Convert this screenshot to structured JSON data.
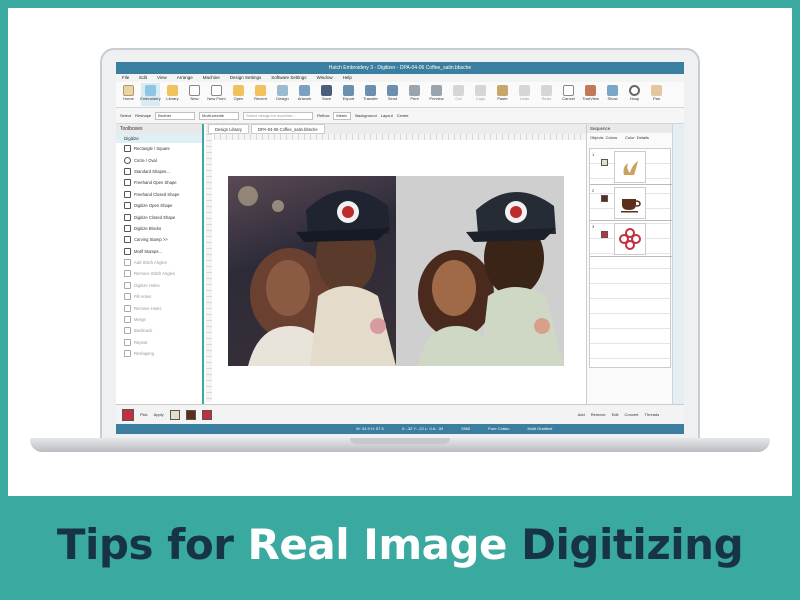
{
  "headline": {
    "part1": "Tips for ",
    "part2": "Real Image",
    "part3": " Digitizing"
  },
  "colors": {
    "teal": "#3aa99f",
    "navy": "#173446",
    "app_blue": "#3a7fa0"
  },
  "app": {
    "title": "Hatch Embroidery 3 - Digitizer - DPA-04-06 Coffee_satin.bbsche",
    "menu": [
      "File",
      "Edit",
      "View",
      "Arrange",
      "Machine",
      "Design Settings",
      "Software Settings",
      "Window",
      "Help"
    ],
    "ribbon": [
      {
        "label": "Home",
        "icon": "home-icon"
      },
      {
        "label": "Embroidery",
        "icon": "embroidery-icon"
      },
      {
        "label": "Library",
        "icon": "library-icon"
      },
      {
        "label": "New",
        "icon": "new-icon"
      },
      {
        "label": "New From",
        "icon": "new-from-icon"
      },
      {
        "label": "Open",
        "icon": "open-icon"
      },
      {
        "label": "Recent",
        "icon": "recent-icon"
      },
      {
        "label": "Design",
        "icon": "design-icon"
      },
      {
        "label": "Artwork",
        "icon": "artwork-icon"
      },
      {
        "label": "Save",
        "icon": "save-icon"
      },
      {
        "label": "Export",
        "icon": "export-icon"
      },
      {
        "label": "Transfer",
        "icon": "transfer-icon"
      },
      {
        "label": "Send",
        "icon": "send-icon"
      },
      {
        "label": "Print",
        "icon": "print-icon"
      },
      {
        "label": "Preview",
        "icon": "preview-icon"
      },
      {
        "label": "Cut",
        "icon": "cut-icon"
      },
      {
        "label": "Copy",
        "icon": "copy-icon"
      },
      {
        "label": "Paste",
        "icon": "paste-icon"
      },
      {
        "label": "Undo",
        "icon": "undo-icon"
      },
      {
        "label": "Redo",
        "icon": "redo-icon"
      },
      {
        "label": "Cancel",
        "icon": "cancel-icon"
      },
      {
        "label": "TrueView",
        "icon": "trueview-icon"
      },
      {
        "label": "Show",
        "icon": "show-icon"
      },
      {
        "label": "Hoop",
        "icon": "hoop-icon"
      },
      {
        "label": "Pan",
        "icon": "pan-icon"
      }
    ],
    "options": {
      "select_label": "Select",
      "reshape_label": "Reshape",
      "brother_value": "Brother",
      "multi_needle_value": "Multi-needle",
      "search_placeholder": "Select design for machine...",
      "reflow_label": "Reflow",
      "metric_value": "Metric",
      "background_label": "Background",
      "layout_label": "Layout",
      "center_label": "Center"
    },
    "toolbox": {
      "title": "Toolboxes",
      "section": "Digitize",
      "items": [
        "Rectangle / Square",
        "Circle / Oval",
        "Standard Shapes...",
        "Freehand Open Shape",
        "Freehand Closed Shape",
        "Digitize Open Shape",
        "Digitize Closed Shape",
        "Digitize Blocks",
        "Carving Stamp >>",
        "Motif Stamps...",
        "Add Stitch Angles",
        "Remove Stitch Angles",
        "Digitize Holes",
        "Fill Holes",
        "Remove Holes",
        "Merge",
        "Backtrack",
        "Repeat",
        "Reshaping"
      ]
    },
    "tabs": [
      "Design Library",
      "DPA-04-06 Coffee_satin.bbsche"
    ],
    "sequence": {
      "title": "Sequence",
      "tab_objects": "Objects",
      "tab_colors": "Colors",
      "col_color": "Color",
      "col_details": "Details",
      "rows": [
        {
          "num": "1",
          "swatch": "#e6dccb",
          "thumb_color": "#c9a25e",
          "icon": "coffee-steam-icon"
        },
        {
          "num": "2",
          "swatch": "#5a2f1c",
          "thumb_color": "#5a2f1c",
          "icon": "coffee-cup-icon"
        },
        {
          "num": "3",
          "swatch": "#c03040",
          "thumb_color": "#c03040",
          "icon": "flower-icon"
        }
      ]
    },
    "bottom": {
      "pick_label": "Pick",
      "apply_label": "Apply",
      "add_label": "Add",
      "remove_label": "Remove",
      "edit_label": "Edit",
      "convert_label": "Convert",
      "threads_label": "Threads"
    },
    "status": {
      "dimensions": "W: 34.9 H: 57.5",
      "coords": "X: -32 Y: -22 L: 0 A: -33",
      "stitches": "2565",
      "stitch_type": "Pure Cotton",
      "machine": "Multi Gradient"
    }
  }
}
